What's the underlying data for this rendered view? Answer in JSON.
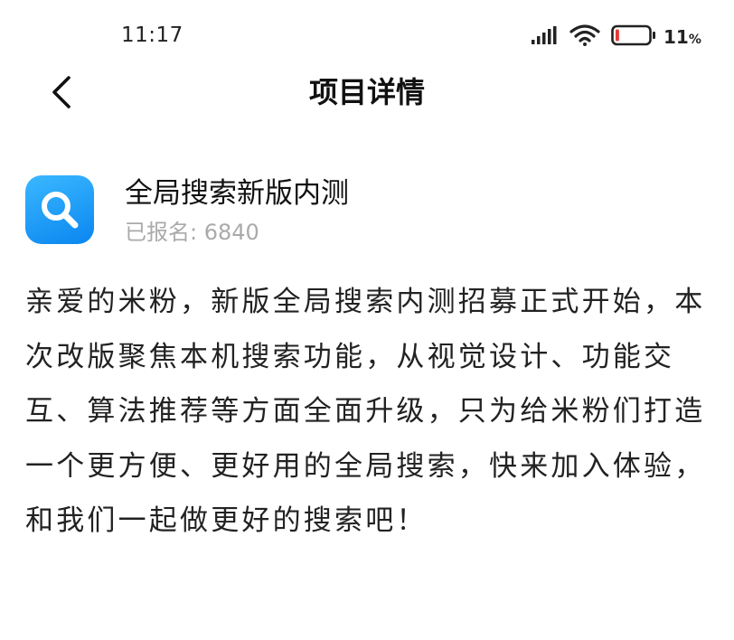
{
  "status_bar": {
    "time": "11:17",
    "battery_level": 0.11,
    "battery_number": "11",
    "battery_unit": "%",
    "signal_icon": "signal-bars-icon",
    "wifi_icon": "wifi-icon",
    "battery_icon": "battery-low-icon",
    "battery_low_color": "#e53935"
  },
  "header": {
    "back_icon": "chevron-left-icon",
    "title": "项目详情"
  },
  "project": {
    "icon": "search-icon",
    "icon_color": "#1a9bff",
    "name": "全局搜索新版内测",
    "signup_label": "已报名: ",
    "signup_count": "6840"
  },
  "description": "亲爱的米粉，新版全局搜索内测招募正式开始，本次改版聚焦本机搜索功能，从视觉设计、功能交互、算法推荐等方面全面升级，只为给米粉们打造一个更方便、更好用的全局搜索，快来加入体验，和我们一起做更好的搜索吧！"
}
